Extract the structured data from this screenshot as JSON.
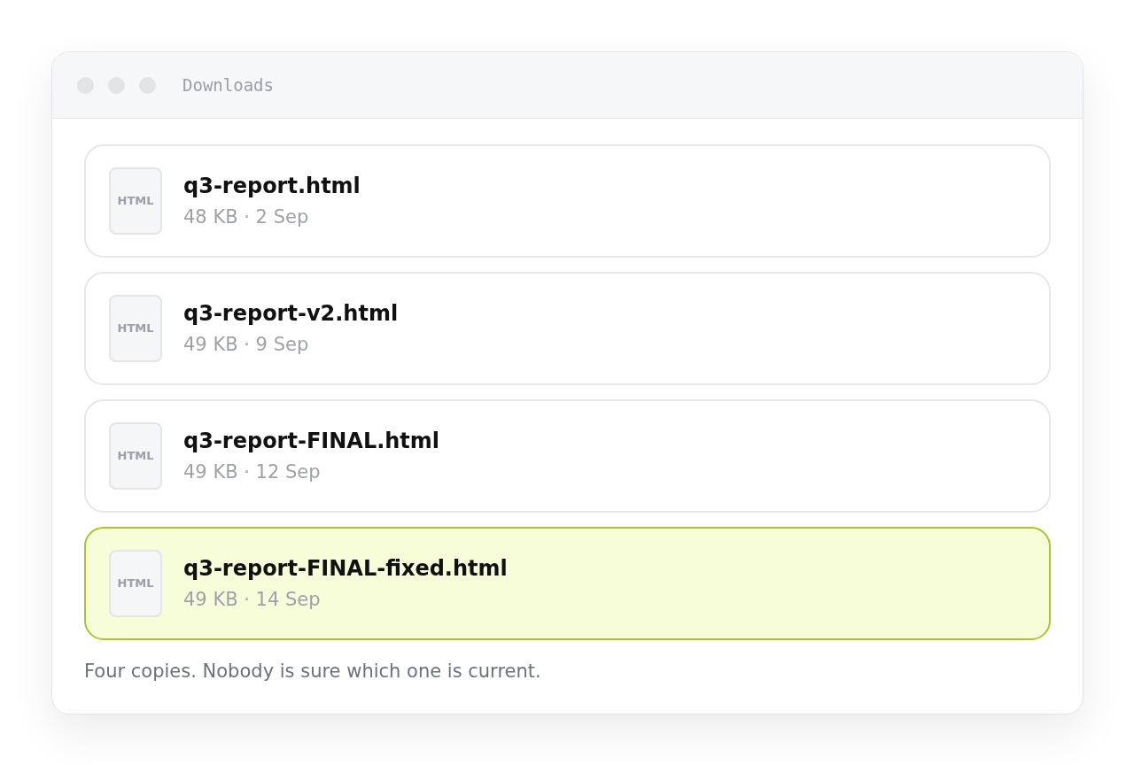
{
  "window": {
    "title": "Downloads"
  },
  "files": [
    {
      "icon_label": "HTML",
      "name": "q3-report.html",
      "meta": "48 KB · 2 Sep",
      "selected": false
    },
    {
      "icon_label": "HTML",
      "name": "q3-report-v2.html",
      "meta": "49 KB · 9 Sep",
      "selected": false
    },
    {
      "icon_label": "HTML",
      "name": "q3-report-FINAL.html",
      "meta": "49 KB · 12 Sep",
      "selected": false
    },
    {
      "icon_label": "HTML",
      "name": "q3-report-FINAL-fixed.html",
      "meta": "49 KB · 14 Sep",
      "selected": true
    }
  ],
  "caption": "Four copies. Nobody is sure which one is current."
}
